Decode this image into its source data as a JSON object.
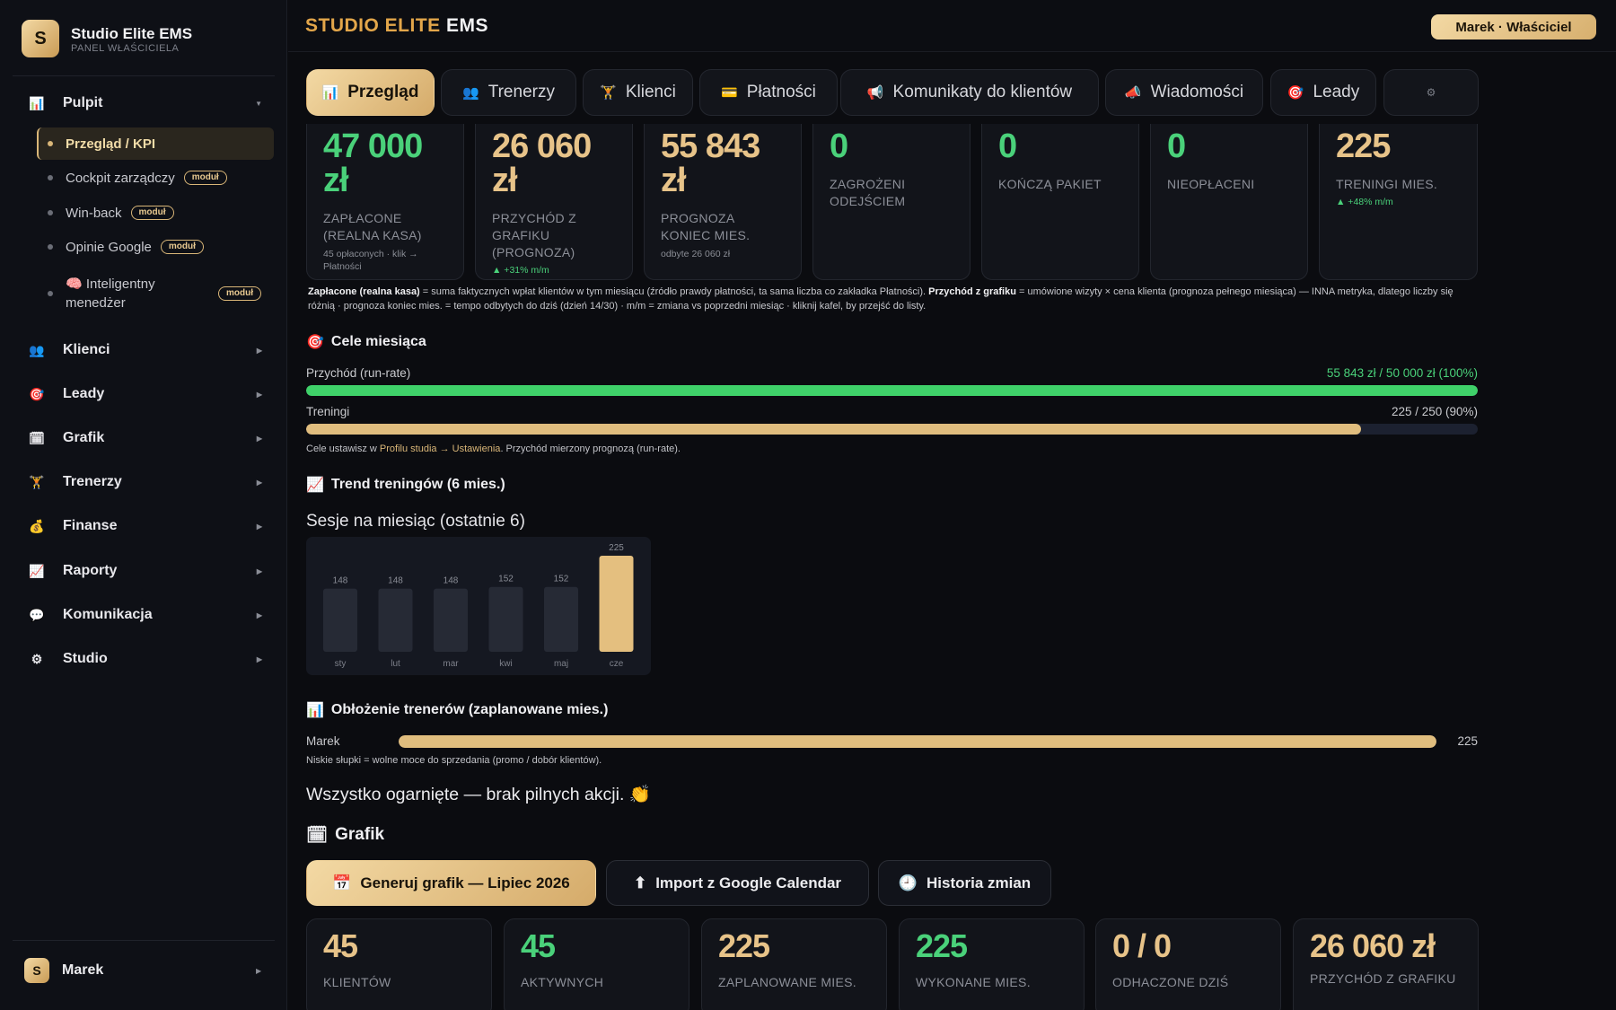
{
  "sidebar": {
    "logo_letter": "S",
    "brand_title": "Studio Elite EMS",
    "brand_subtitle": "PANEL WŁAŚCICIELA",
    "sections": [
      {
        "label": "Pulpit",
        "icon": "bar-chart-icon",
        "glyph": "📊"
      },
      {
        "label": "Klienci",
        "icon": "people-icon",
        "glyph": "👥"
      },
      {
        "label": "Leady",
        "icon": "target-icon",
        "glyph": "🎯"
      },
      {
        "label": "Grafik",
        "icon": "calendar-icon",
        "glyph": "🗓"
      },
      {
        "label": "Trenerzy",
        "icon": "weightlifter-icon",
        "glyph": "🏋"
      },
      {
        "label": "Finanse",
        "icon": "money-bag-icon",
        "glyph": "💰"
      },
      {
        "label": "Raporty",
        "icon": "trend-chart-icon",
        "glyph": "📈"
      },
      {
        "label": "Komunikacja",
        "icon": "speech-bubble-icon",
        "glyph": "💬"
      },
      {
        "label": "Studio",
        "icon": "gear-icon",
        "glyph": "⚙"
      }
    ],
    "pulpit_items": [
      {
        "label": "Przegląd / KPI",
        "badge": ""
      },
      {
        "label": "Cockpit zarządczy",
        "badge": "moduł"
      },
      {
        "label": "Win-back",
        "badge": "moduł"
      },
      {
        "label": "Opinie Google",
        "badge": "moduł"
      },
      {
        "label": "🧠 Inteligentny menedżer",
        "badge": "moduł"
      }
    ],
    "user": {
      "initial": "S",
      "name": "Marek"
    }
  },
  "header": {
    "title_gold": "STUDIO ELITE",
    "title_white": "EMS",
    "owner_button": "Marek · Właściciel"
  },
  "tabs": [
    {
      "label": "Przegląd",
      "icon": "bar-chart-icon",
      "glyph": "📊"
    },
    {
      "label": "Trenerzy",
      "icon": "people-icon",
      "glyph": "👥"
    },
    {
      "label": "Klienci",
      "icon": "weightlifter-icon",
      "glyph": "🏋"
    },
    {
      "label": "Płatności",
      "icon": "credit-card-icon",
      "glyph": "💳"
    },
    {
      "label": "Komunikaty do klientów",
      "icon": "megaphone-icon",
      "glyph": "📢"
    },
    {
      "label": "Wiadomości",
      "icon": "loudspeaker-icon",
      "glyph": "📣"
    },
    {
      "label": "Leady",
      "icon": "target-icon",
      "glyph": "🎯"
    },
    {
      "label": "",
      "icon": "gear-icon",
      "glyph": "⚙"
    }
  ],
  "kpis": [
    {
      "value": "47 000 zł",
      "label": "ZAPŁACONE (REALNA KASA)",
      "meta": "45 opłaconych · klik → Płatności",
      "delta": "",
      "color": "#4ad17a"
    },
    {
      "value": "26 060 zł",
      "label": "PRZYCHÓD Z GRAFIKU (PROGNOZA)",
      "meta": "",
      "delta": "▲ +31% m/m",
      "color": "#e7c389"
    },
    {
      "value": "55 843 zł",
      "label": "PROGNOZA KONIEC MIES.",
      "meta": "odbyte 26 060 zł",
      "delta": "",
      "color": "#e7c389"
    },
    {
      "value": "0",
      "label": "ZAGROŻENI ODEJŚCIEM",
      "meta": "",
      "delta": "",
      "color": "#4ad17a"
    },
    {
      "value": "0",
      "label": "KOŃCZĄ PAKIET",
      "meta": "",
      "delta": "",
      "color": "#4ad17a"
    },
    {
      "value": "0",
      "label": "NIEOPŁACENI",
      "meta": "",
      "delta": "",
      "color": "#4ad17a"
    },
    {
      "value": "225",
      "label": "TRENINGI MIES.",
      "meta": "",
      "delta": "▲ +48% m/m",
      "color": "#e7c389"
    }
  ],
  "kpi_note": {
    "b1": "Zapłacone (realna kasa)",
    "t1": " = suma faktycznych wpłat klientów w tym miesiącu (źródło prawdy płatności, ta sama liczba co zakładka Płatności). ",
    "b2": "Przychód z grafiku",
    "t2": " = umówione wizyty × cena klienta (prognoza pełnego miesiąca) — INNA metryka, dlatego liczby się różnią · prognoza koniec mies. = tempo odbytych do dziś (dzień 14/30) · m/m = zmiana vs poprzedni miesiąc · kliknij kafel, by przejść do listy."
  },
  "goals": {
    "title": "Cele miesiąca",
    "revenue_label": "Przychód (run-rate)",
    "revenue_value": "55 843 zł / 50 000 zł (100%)",
    "revenue_fraction": 1.0,
    "revenue_color": "#3fd169",
    "trainings_label": "Treningi",
    "trainings_value": "225 / 250 (90%)",
    "trainings_fraction": 0.9,
    "trainings_color": "#e0bd7e",
    "note_a": "Cele ustawisz w ",
    "note_link": "Profilu studia → Ustawienia",
    "note_b": ". Przychód mierzony prognozą (run-rate)."
  },
  "trend": {
    "title": "Trend treningów (6 mies.)",
    "chart_title": "Sesje na miesiąc (ostatnie 6)"
  },
  "chart_data": {
    "type": "bar",
    "title": "Sesje na miesiąc (ostatnie 6)",
    "categories": [
      "sty",
      "lut",
      "mar",
      "kwi",
      "maj",
      "cze"
    ],
    "values": [
      148,
      148,
      148,
      152,
      152,
      225
    ],
    "highlight_index": 5,
    "bar_color": "#262a35",
    "highlight_color": "#e4bf7f",
    "ylim": [
      0,
      225
    ]
  },
  "trainers": {
    "title": "Obłożenie trenerów (zaplanowane mies.)",
    "rows": [
      {
        "name": "Marek",
        "value": "225",
        "fraction": 1.0
      }
    ],
    "note": "Niskie słupki = wolne moce do sprzedania (promo / dobór klientów)."
  },
  "status_message": "Wszystko ogarnięte — brak pilnych akcji. 👏",
  "grafik": {
    "title": "Grafik",
    "buttons": [
      {
        "label": "Generuj grafik — Lipiec 2026",
        "glyph": "📅",
        "icon": "calendar-icon"
      },
      {
        "label": "Import z Google Calendar",
        "glyph": "⬆",
        "icon": "upload-icon"
      },
      {
        "label": "Historia zmian",
        "glyph": "🕘",
        "icon": "clock-icon"
      }
    ],
    "cards": [
      {
        "value": "45",
        "label": "KLIENTÓW",
        "color": "#e7c389"
      },
      {
        "value": "45",
        "label": "AKTYWNYCH",
        "color": "#4ad17a"
      },
      {
        "value": "225",
        "label": "ZAPLANOWANE MIES.",
        "color": "#e7c389"
      },
      {
        "value": "225",
        "label": "WYKONANE MIES.",
        "color": "#4ad17a"
      },
      {
        "value": "0 / 0",
        "label": "ODHACZONE DZIŚ",
        "color": "#e7c389"
      },
      {
        "value": "26 060 zł",
        "label": "PRZYCHÓD Z GRAFIKU",
        "color": "#e7c389"
      }
    ]
  }
}
